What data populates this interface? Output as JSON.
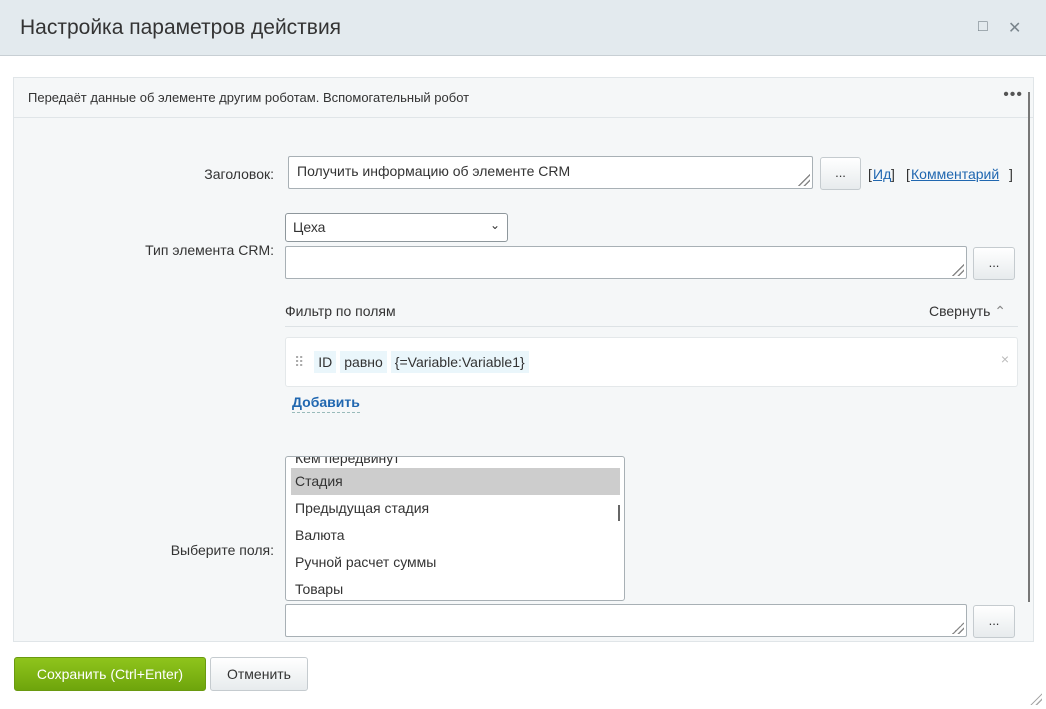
{
  "header": {
    "title": "Настройка параметров действия",
    "maximize_icon": "□",
    "close_icon": "✕"
  },
  "description": "Передаёт данные об элементе другим роботам. Вспомогательный робот",
  "more_icon": "•••",
  "form": {
    "title_label": "Заголовок:",
    "title_value": "Получить информацию об элементе CRM",
    "dots": "...",
    "id_link": "Ид",
    "comment_link": "Комментарий",
    "type_label": "Тип элемента CRM:",
    "type_value": "Цеха",
    "filter": {
      "title": "Фильтр по полям",
      "collapse": "Свернуть",
      "field": "ID",
      "operator": "равно",
      "value": "{=Variable:Variable1}",
      "add": "Добавить"
    },
    "fields_label": "Выберите поля:",
    "fields": [
      "Кем передвинут",
      "Стадия",
      "Предыдущая стадия",
      "Валюта",
      "Ручной расчет суммы",
      "Товары"
    ]
  },
  "footer": {
    "save": "Сохранить (Ctrl+Enter)",
    "cancel": "Отменить"
  }
}
